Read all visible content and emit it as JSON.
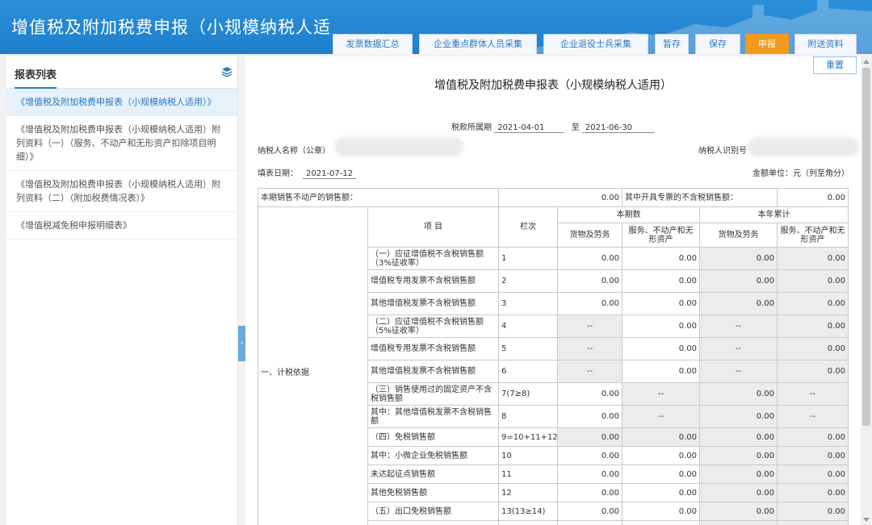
{
  "header": {
    "title": "增值税及附加税费申报（小规模纳税人适",
    "tabs": [
      {
        "label": "发票数据汇总",
        "active": false
      },
      {
        "label": "企业重点群体人员采集",
        "active": false
      },
      {
        "label": "企业退役士兵采集",
        "active": false
      },
      {
        "label": "暂存",
        "active": false
      },
      {
        "label": "保存",
        "active": false
      },
      {
        "label": "申报",
        "active": true
      },
      {
        "label": "附送资料",
        "active": false
      }
    ],
    "accent_color": "#1e7fcc",
    "active_tab_color": "#f39a1e"
  },
  "sidebar": {
    "title": "报表列表",
    "icon": "layers-icon",
    "items": [
      {
        "label": "《增值税及附加税费申报表（小规模纳税人适用）》",
        "active": true
      },
      {
        "label": "《增值税及附加税费申报表（小规模纳税人适用）附列资料（一）（服务、不动产和无形资产扣除项目明细）》",
        "active": false
      },
      {
        "label": "《增值税及附加税费申报表（小规模纳税人适用）附列资料（二）（附加税费情况表）》",
        "active": false
      },
      {
        "label": "《增值税减免税申报明细表》",
        "active": false
      }
    ]
  },
  "main": {
    "reset_label": "重置",
    "form_title": "增值税及附加税费申报表（小规模纳税人适用）",
    "period_label": "税款所属期",
    "period_start": "2021-04-01",
    "period_sep": "至",
    "period_end": "2021-06-30",
    "taxpayer_name_label": "纳税人名称（公章）",
    "taxpayer_id_label": "纳税人识别号",
    "fill_date_label": "填表日期：",
    "fill_date": "2021-07-12",
    "unit_label": "金额单位：元（列至角分）",
    "top_row": {
      "left_label": "本期销售不动产的销售额：",
      "left_value": "0.00",
      "right_label": "其中开具专票的不含税销售额：",
      "right_value": "0.00"
    },
    "section_label": "一、计税依据",
    "headers": {
      "item": "项  目",
      "col": "栏次",
      "current": "本期数",
      "ytd": "本年累计",
      "goods": "货物及劳务",
      "services": "服务、不动产和无形资产"
    },
    "rows": [
      {
        "item": "（一）应征增值税不含税销售额（3%征收率）",
        "col": "1",
        "v1": "0.00",
        "v2": "0.00",
        "v3": "0.00",
        "v4": "0.00"
      },
      {
        "item": "增值税专用发票不含税销售额",
        "col": "2",
        "v1": "0.00",
        "v2": "0.00",
        "v3": "0.00",
        "v4": "0.00"
      },
      {
        "item": "其他增值税发票不含税销售额",
        "col": "3",
        "v1": "0.00",
        "v2": "0.00",
        "v3": "0.00",
        "v4": "0.00"
      },
      {
        "item": "（二）应征增值税不含税销售额（5%征收率）",
        "col": "4",
        "v1": "--",
        "v2": "0.00",
        "v3": "--",
        "v4": "0.00"
      },
      {
        "item": "增值税专用发票不含税销售额",
        "col": "5",
        "v1": "--",
        "v2": "0.00",
        "v3": "--",
        "v4": "0.00"
      },
      {
        "item": "其他增值税发票不含税销售额",
        "col": "6",
        "v1": "--",
        "v2": "0.00",
        "v3": "--",
        "v4": "0.00"
      },
      {
        "item": "（三）销售使用过的固定资产不含税销售额",
        "col": "7(7≥8)",
        "v1": "0.00",
        "v2": "--",
        "v3": "0.00",
        "v4": "--"
      },
      {
        "item": "其中：其他增值税发票不含税销售额",
        "col": "8",
        "v1": "0.00",
        "v2": "--",
        "v3": "0.00",
        "v4": "--"
      },
      {
        "item": "（四）免税销售额",
        "col": "9=10+11+12",
        "v1": "0.00",
        "v2": "0.00",
        "v3": "0.00",
        "v4": "0.00"
      },
      {
        "item": "其中：小微企业免税销售额",
        "col": "10",
        "v1": "0.00",
        "v2": "0.00",
        "v3": "0.00",
        "v4": "0.00"
      },
      {
        "item": "未达起征点销售额",
        "col": "11",
        "v1": "0.00",
        "v2": "0.00",
        "v3": "0.00",
        "v4": "0.00"
      },
      {
        "item": "其他免税销售额",
        "col": "12",
        "v1": "0.00",
        "v2": "0.00",
        "v3": "0.00",
        "v4": "0.00"
      },
      {
        "item": "（五）出口免税销售额",
        "col": "13(13≥14)",
        "v1": "0.00",
        "v2": "0.00",
        "v3": "0.00",
        "v4": "0.00"
      }
    ]
  }
}
